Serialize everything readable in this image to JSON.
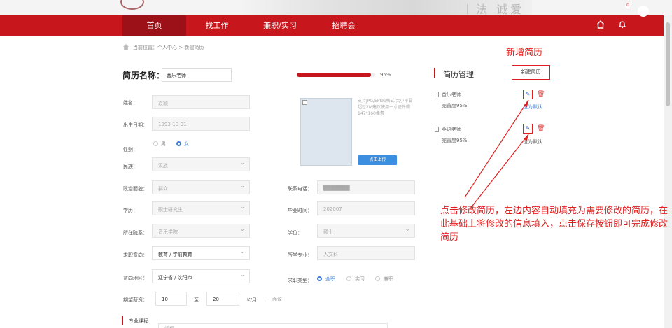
{
  "banner": {
    "logo_text": "···",
    "mural_text": "丨法 诚爱"
  },
  "nav": {
    "items": [
      {
        "label": "首页",
        "active": true
      },
      {
        "label": "找工作"
      },
      {
        "label": "兼职/实习"
      },
      {
        "label": "招聘会"
      }
    ],
    "bell_count": "0",
    "icons": [
      "home-icon",
      "bell-icon",
      "avatar"
    ]
  },
  "breadcrumb": "当前位置：个人中心 > 新建简历",
  "resume": {
    "name_label": "简历名称：",
    "name_value": "音乐老师",
    "progress": 0.95,
    "progress_text": "95%"
  },
  "form": {
    "name_label": "姓名：",
    "name_value": "袁颖",
    "birth_label": "出生日期：",
    "birth_value": "1993-10-31",
    "gender_label": "性别：",
    "gender_male": "男",
    "gender_female": "女",
    "gender_selected": "女",
    "ethnic_label": "民族：",
    "ethnic_value": "汉族",
    "politics_label": "政治面貌：",
    "politics_value": "群众",
    "education_label": "学历：",
    "education_value": "硕士研究生",
    "department_label": "所在院系：",
    "department_value": "音乐学院",
    "job_intent_label": "求职意向：",
    "job_intent_value": "教育 / 学前教育",
    "region_label": "意向地区：",
    "region_value": "辽宁省 / 沈阳市",
    "salary_label": "期望薪资：",
    "salary_min": "10",
    "salary_to": "至",
    "salary_max": "20",
    "salary_unit": "K/月",
    "salary_negotiable": "面议",
    "phone_label": "联系电话：",
    "phone_value": "███████",
    "graduation_label": "毕业时间：",
    "graduation_value": "202007",
    "degree_label": "学位：",
    "degree_value": "硕士",
    "major_label": "所学专业：",
    "major_value": "人文科",
    "job_type_label": "求职类型：",
    "job_type_full": "全职",
    "job_type_intern": "实习",
    "job_type_part": "兼职",
    "job_type_selected": "全职",
    "photo_note": "支持JPG/EPNG格式,大小不要超过2M建议使用一寸证件照147*160像素",
    "upload_label": "点击上传",
    "course_section": "专业课程",
    "course_value": "课程"
  },
  "sidebar": {
    "title": "简历管理",
    "new_button": "新建简历",
    "resumes": [
      {
        "name": "音乐老师",
        "completion": "完善度95%",
        "set_default": "设为默认"
      },
      {
        "name": "英语老师",
        "completion": "完善度95%",
        "set_default": "设为默认"
      }
    ]
  },
  "annotations": {
    "new_resume": "新增简历",
    "edit_hint": "点击修改简历，左边内容自动填充为需要修改的简历，在此基础上将修改的信息填入，点击保存按钮即可完成修改简历",
    "color": "#e02020"
  },
  "colors": {
    "brand": "#c8161d",
    "brand_dark": "#9c1117",
    "accent_blue": "#3b7dd8"
  }
}
